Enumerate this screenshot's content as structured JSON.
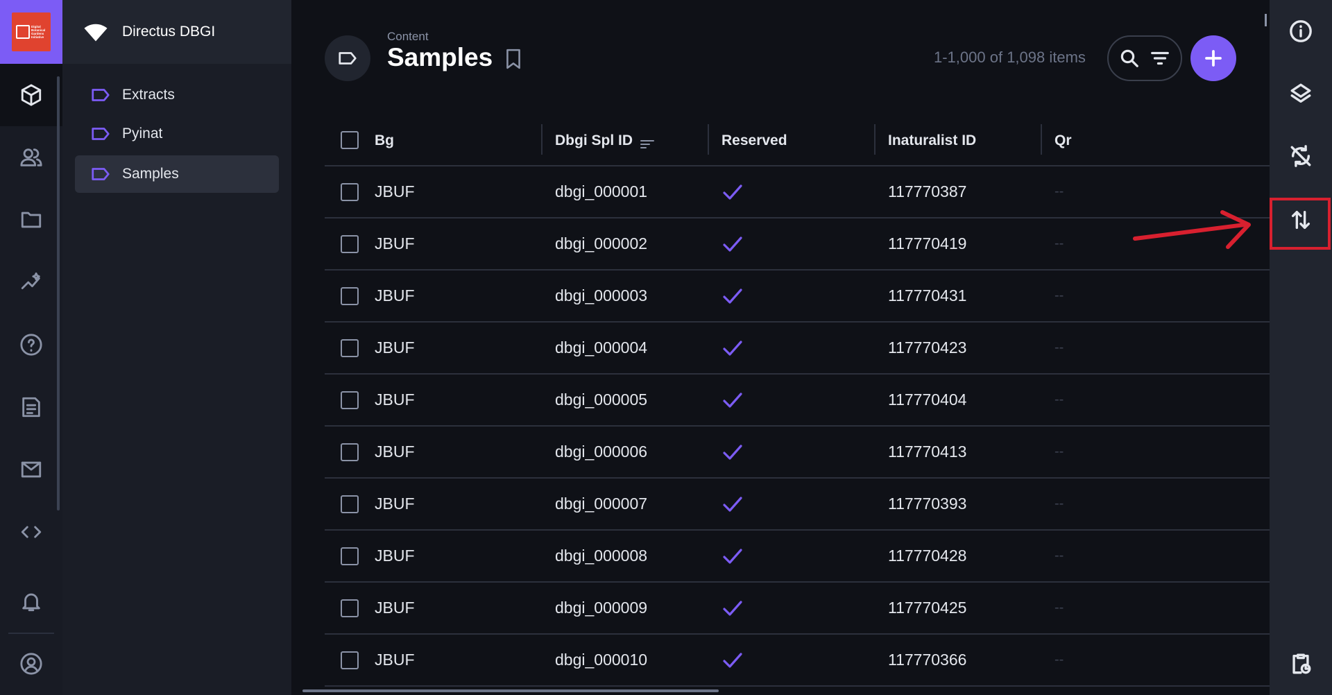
{
  "module_bar": {
    "logo_text": "Digital Botanical Gardens Initiative",
    "items": [
      {
        "name": "content",
        "icon": "cube-icon",
        "active": true
      },
      {
        "name": "users",
        "icon": "users-icon"
      },
      {
        "name": "files",
        "icon": "folder-icon"
      },
      {
        "name": "insights",
        "icon": "insights-icon"
      },
      {
        "name": "help",
        "icon": "help-icon"
      },
      {
        "name": "docs",
        "icon": "document-icon"
      },
      {
        "name": "mail",
        "icon": "mail-icon"
      },
      {
        "name": "settings",
        "icon": "code-icon"
      },
      {
        "name": "notifications",
        "icon": "bell-icon"
      },
      {
        "name": "profile",
        "icon": "user-circle-icon"
      }
    ]
  },
  "navigation": {
    "project_name": "Directus DBGI",
    "items": [
      {
        "label": "Extracts"
      },
      {
        "label": "Pyinat"
      },
      {
        "label": "Samples",
        "active": true
      }
    ]
  },
  "header": {
    "breadcrumb": "Content",
    "title": "Samples",
    "item_count": "1-1,000 of 1,098 items"
  },
  "table": {
    "columns": [
      "Bg",
      "Dbgi Spl ID",
      "Reserved",
      "Inaturalist ID",
      "Qr"
    ],
    "rows": [
      {
        "bg": "JBUF",
        "spl_id": "dbgi_000001",
        "reserved": true,
        "inat_id": "117770387",
        "qr": "--"
      },
      {
        "bg": "JBUF",
        "spl_id": "dbgi_000002",
        "reserved": true,
        "inat_id": "117770419",
        "qr": "--"
      },
      {
        "bg": "JBUF",
        "spl_id": "dbgi_000003",
        "reserved": true,
        "inat_id": "117770431",
        "qr": "--"
      },
      {
        "bg": "JBUF",
        "spl_id": "dbgi_000004",
        "reserved": true,
        "inat_id": "117770423",
        "qr": "--"
      },
      {
        "bg": "JBUF",
        "spl_id": "dbgi_000005",
        "reserved": true,
        "inat_id": "117770404",
        "qr": "--"
      },
      {
        "bg": "JBUF",
        "spl_id": "dbgi_000006",
        "reserved": true,
        "inat_id": "117770413",
        "qr": "--"
      },
      {
        "bg": "JBUF",
        "spl_id": "dbgi_000007",
        "reserved": true,
        "inat_id": "117770393",
        "qr": "--"
      },
      {
        "bg": "JBUF",
        "spl_id": "dbgi_000008",
        "reserved": true,
        "inat_id": "117770428",
        "qr": "--"
      },
      {
        "bg": "JBUF",
        "spl_id": "dbgi_000009",
        "reserved": true,
        "inat_id": "117770425",
        "qr": "--"
      },
      {
        "bg": "JBUF",
        "spl_id": "dbgi_000010",
        "reserved": true,
        "inat_id": "117770366",
        "qr": "--"
      }
    ]
  },
  "sidebar": {
    "items": [
      {
        "name": "info",
        "icon": "info-icon"
      },
      {
        "name": "layout",
        "icon": "layers-icon"
      },
      {
        "name": "flows",
        "icon": "sync-disabled-icon"
      },
      {
        "name": "import-export",
        "icon": "import-export-icon"
      },
      {
        "name": "revisions",
        "icon": "clipboard-clock-icon"
      }
    ]
  },
  "colors": {
    "accent": "#7c5cf5",
    "annotation": "#d8202f",
    "logo_bg": "#e0432f"
  }
}
